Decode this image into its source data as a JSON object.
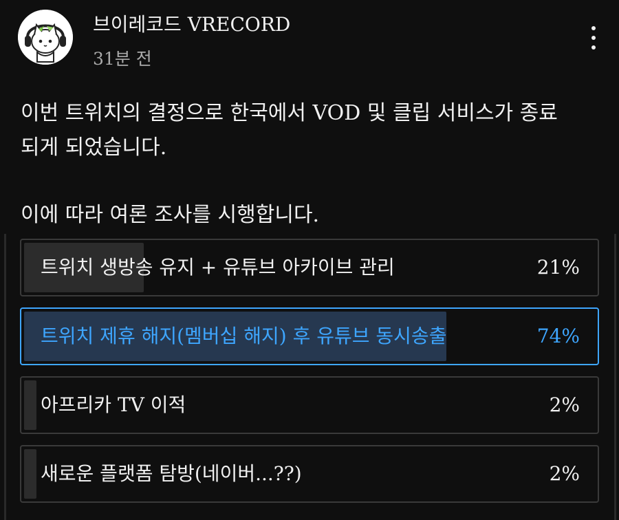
{
  "post": {
    "channel_name": "브이레코드 VRECORD",
    "time_ago": "31분 전",
    "avatar_icon": "cat-headphones-avatar-icon",
    "menu_icon": "more-vertical-icon",
    "body_line_1": "이번 트위치의 결정으로 한국에서 VOD 및 클립 서비스가 종료",
    "body_line_2": "되게 되었습니다.",
    "body_line_3": "이에 따라 여론 조사를 시행합니다."
  },
  "poll": {
    "accent_color": "#3ea6ff",
    "options": [
      {
        "label": "트위치 생방송 유지 + 유튜브 아카이브 관리",
        "percent_label": "21%",
        "percent": 21,
        "selected": false
      },
      {
        "label": "트위치 제휴 해지(멤버십 해지) 후 유튜브 동시송출",
        "percent_label": "74%",
        "percent": 74,
        "selected": true
      },
      {
        "label": "아프리카 TV 이적",
        "percent_label": "2%",
        "percent": 2,
        "selected": false
      },
      {
        "label": "새로운 플랫폼 탐방(네이버...??)",
        "percent_label": "2%",
        "percent": 2,
        "selected": false
      }
    ]
  }
}
